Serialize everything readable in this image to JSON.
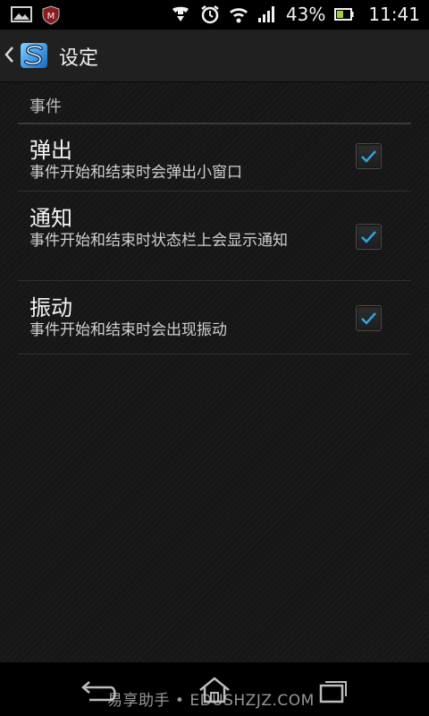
{
  "status_bar": {
    "battery_percent": "43%",
    "time": "11:41",
    "icons": [
      "gallery-notification-icon",
      "mcafee-icon",
      "call-forward-icon",
      "alarm-icon",
      "wifi-icon",
      "signal-icon",
      "battery-icon"
    ]
  },
  "action_bar": {
    "title": "设定",
    "app_icon": "app-logo-icon"
  },
  "settings": {
    "category": "事件",
    "items": [
      {
        "title": "弹出",
        "summary": "事件开始和结束时会弹出小窗口",
        "checked": true
      },
      {
        "title": "通知",
        "summary": "事件开始和结束时状态栏上会显示通知",
        "checked": true
      },
      {
        "title": "振动",
        "summary": "事件开始和结束时会出现振动",
        "checked": true
      }
    ]
  },
  "nav_bar": {
    "buttons": [
      "back-icon",
      "home-icon",
      "recent-apps-icon"
    ],
    "watermark": "易享助手 • EDUSHZJZ.COM"
  },
  "colors": {
    "check_accent": "#2fa5e0",
    "background": "#161616",
    "action_bar": "#202020"
  }
}
